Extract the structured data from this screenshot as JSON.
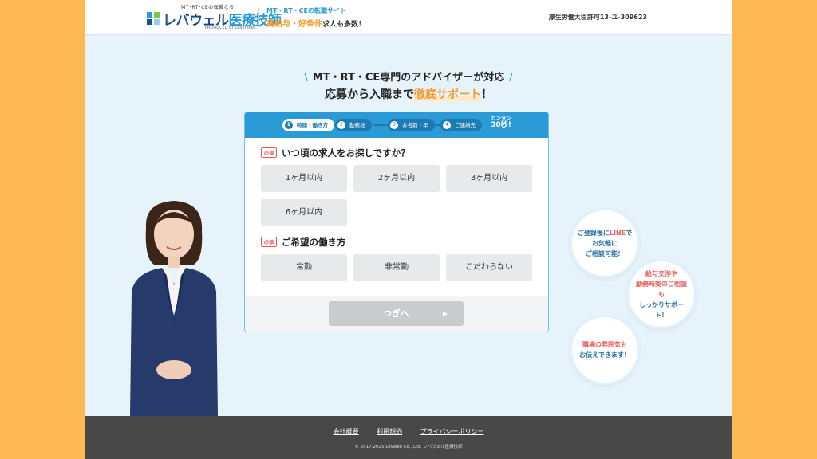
{
  "header": {
    "logo_tagline": "MT･RT･CEの転職なら",
    "logo_main": "レバウェル",
    "logo_accent": "医療技師",
    "logo_produced": "PRODUCED BY Leverages",
    "site_tag": "MT・RT・CEの転職サイト",
    "promo_highlight": "高給与・好条件",
    "promo_rest": "求人も多数！",
    "license": "厚生労働大臣許可13-ユ-309623"
  },
  "hero": {
    "headline1": "MT・RT・CE専門のアドバイザーが対応",
    "headline2_pre": "応募から入職まで",
    "headline2_accent": "徹底サポート",
    "headline2_post": "！"
  },
  "steps": {
    "items": [
      {
        "num": "1",
        "label": "時間・働き方"
      },
      {
        "num": "2",
        "label": "勤務地"
      },
      {
        "num": "3",
        "label": "お名前・年"
      },
      {
        "num": "4",
        "label": "ご連絡先"
      }
    ],
    "note_top": "カンタン",
    "note_bottom": "30秒!"
  },
  "form": {
    "required_label": "必須",
    "q1": "いつ頃の求人をお探しですか？",
    "q1_options": [
      "1ヶ月以内",
      "2ヶ月以内",
      "3ヶ月以内",
      "6ヶ月以内"
    ],
    "q2": "ご希望の働き方",
    "q2_options": [
      "常勤",
      "非常勤",
      "こだわらない"
    ],
    "next_label": "つぎへ",
    "next_arrow": "▶"
  },
  "bubbles": [
    {
      "l1a": "ご登録後に",
      "l1b": "LINE",
      "l1c": "で",
      "l2": "お気軽に",
      "l3": "ご相談可能！"
    },
    {
      "l1": "給与交渉や",
      "l2": "勤務時間のご相談も",
      "l3": "しっかりサポート！"
    },
    {
      "l1": "職場の雰囲気も",
      "l2": "お伝えできます！"
    }
  ],
  "footer": {
    "links": [
      "会社概要",
      "利用規約",
      "プライバシーポリシー"
    ],
    "copyright": "© 2017-2025 Levwell Co., Ltd. レバウェル医療技師"
  },
  "colors": {
    "accent_blue": "#2a9bd6",
    "accent_orange": "#f39a2c",
    "frame_orange": "#ffb954",
    "required_red": "#e65a5a"
  }
}
